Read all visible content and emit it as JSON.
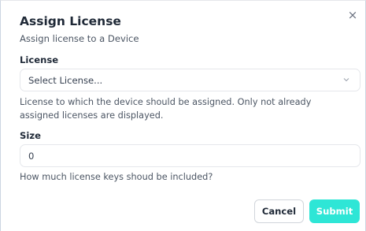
{
  "dialog": {
    "title": "Assign License",
    "subtitle": "Assign license to a Device",
    "close_glyph": "×"
  },
  "license": {
    "label": "License",
    "placeholder": "Select License...",
    "help": "License to which the device should be assigned. Only not already assigned licenses are displayed."
  },
  "size": {
    "label": "Size",
    "value": "0",
    "help": "How much license keys shoud be included?"
  },
  "actions": {
    "cancel_label": "Cancel",
    "submit_label": "Submit"
  },
  "colors": {
    "accent": "#2ee6d6",
    "border": "#e5e7eb"
  }
}
